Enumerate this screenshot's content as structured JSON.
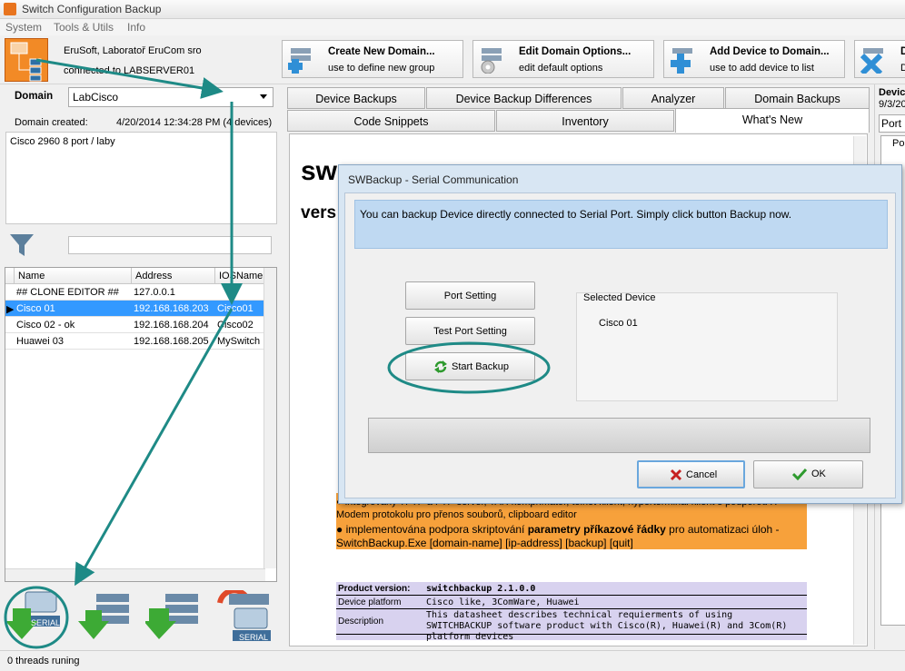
{
  "window": {
    "title": "Switch Configuration Backup"
  },
  "menu": [
    "System",
    "Tools & Utils",
    "Info"
  ],
  "header": {
    "org": "EruSoft, Laboratoř EruCom sro",
    "connection": "connected to LABSERVER01"
  },
  "toolbar": [
    {
      "title": "Create New Domain...",
      "subtitle": "use to define new group"
    },
    {
      "title": "Edit Domain Options...",
      "subtitle": "edit default options"
    },
    {
      "title": "Add Device to Domain...",
      "subtitle": "use to add device to list"
    },
    {
      "title": "D",
      "subtitle": "D"
    }
  ],
  "domain": {
    "label": "Domain",
    "selected": "LabCisco",
    "created_label": "Domain created:",
    "created_value": "4/20/2014 12:34:28 PM (4 devices)",
    "description": "Cisco 2960 8 port / laby"
  },
  "grid": {
    "columns": [
      "Name",
      "Address",
      "IOSName"
    ],
    "rows": [
      [
        "## CLONE EDITOR ##",
        "127.0.0.1",
        ""
      ],
      [
        "Cisco 01",
        "192.168.168.203",
        "Cisco01"
      ],
      [
        "Cisco 02 - ok",
        "192.168.168.204",
        "Cisco02"
      ],
      [
        "Huawei 03",
        "192.168.168.205",
        "MySwitch"
      ]
    ],
    "selected_row": 1
  },
  "bottom_icons": {
    "serial_label": "SERIAL",
    "serial2_label": "SERIAL"
  },
  "status": {
    "text": "0    threads runing"
  },
  "tabs_row1": [
    "Device Backups",
    "Device Backup Differences",
    "Analyzer",
    "Domain Backups"
  ],
  "tabs_row2": [
    "Code Snippets",
    "Inventory",
    "What's New"
  ],
  "right_panel": {
    "title": "Devic",
    "date": "9/3/20",
    "tab": "Port",
    "col": "Po"
  },
  "document": {
    "title": "sw",
    "subtitle": "vers",
    "bullet1": "integrovaný TFTP a FTP server, TAR komprimátor, telnet klient, hyperterminál klient s podporou X-Modem protokolu pro přenos souborů, clipboard editor",
    "bullet2_pre": "implementována podpora skriptování",
    "bullet2_bold": "parametry příkazové řádky",
    "bullet2_post": "pro automatizaci úloh - SwitchBackup.Exe [domain-name] [ip-address] [backup] [quit]",
    "product": [
      [
        "Product version:",
        "switchbackup 2.1.0.0"
      ],
      [
        "Device platform",
        "Cisco like, 3ComWare, Huawei"
      ],
      [
        "Description",
        "This datasheet describes technical requierments of using SWITCHBACKUP software product with Cisco(R), Huawei(R) and 3Com(R) platform devices"
      ]
    ]
  },
  "modal": {
    "title": "SWBackup - Serial Communication",
    "info": "You can backup Device directly connected to Serial Port. Simply click button Backup now.",
    "port_setting": "Port Setting",
    "test_port": "Test Port Setting",
    "start_backup": "Start Backup",
    "selected_label": "Selected Device",
    "selected_value": "Cisco 01",
    "cancel": "Cancel",
    "ok": "OK"
  },
  "colors": {
    "accent": "#3399ff",
    "annotation": "#1e8a86",
    "orange": "#f7a13b"
  }
}
